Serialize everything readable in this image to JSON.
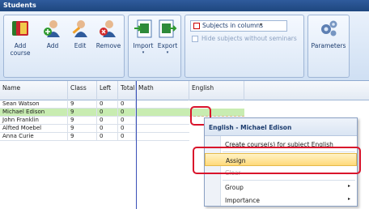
{
  "window": {
    "title": "Students"
  },
  "ribbon": {
    "buttons": [
      {
        "label": "Add course",
        "icon": "add-course-icon"
      },
      {
        "label": "Add",
        "icon": "add-user-icon"
      },
      {
        "label": "Edit",
        "icon": "edit-user-icon"
      },
      {
        "label": "Remove",
        "icon": "remove-user-icon"
      },
      {
        "label": "Import",
        "icon": "import-icon"
      },
      {
        "label": "Export",
        "icon": "export-icon"
      }
    ],
    "subjects_dropdown": {
      "value": "Subjects in columns"
    },
    "hide_checkbox": {
      "label": "Hide subjects without seminars",
      "checked": false
    },
    "parameters": {
      "label": "Parameters",
      "icon": "gears-icon"
    }
  },
  "grid": {
    "columns": [
      "Name",
      "Class",
      "Left",
      "Total",
      "Math",
      "English"
    ],
    "rows": [
      {
        "name": "Sean Watson",
        "class": "9",
        "left": "0",
        "total": "0"
      },
      {
        "name": "Michael Edison",
        "class": "9",
        "left": "0",
        "total": "0"
      },
      {
        "name": "John Franklin",
        "class": "9",
        "left": "0",
        "total": "0"
      },
      {
        "name": "Alfted Moebel",
        "class": "9",
        "left": "0",
        "total": "0"
      },
      {
        "name": "Anna Curie",
        "class": "9",
        "left": "0",
        "total": "0"
      }
    ],
    "selected_row": "Michael Edison"
  },
  "context_menu": {
    "title": "English - Michael Edison",
    "items": [
      {
        "label": "Create course(s) for subject English",
        "enabled": true
      },
      {
        "label": "Assign",
        "enabled": true,
        "highlighted": true
      },
      {
        "label": "Clear",
        "enabled": false
      },
      {
        "label": "Group",
        "enabled": true,
        "submenu": true
      },
      {
        "label": "Importance",
        "enabled": true,
        "submenu": true
      }
    ],
    "submenu_arrow": "▸"
  },
  "colors": {
    "accent": "#1e477f",
    "selection": "#c8ecb1",
    "highlight": "#ffd97a",
    "annotation": "#d9132b"
  }
}
